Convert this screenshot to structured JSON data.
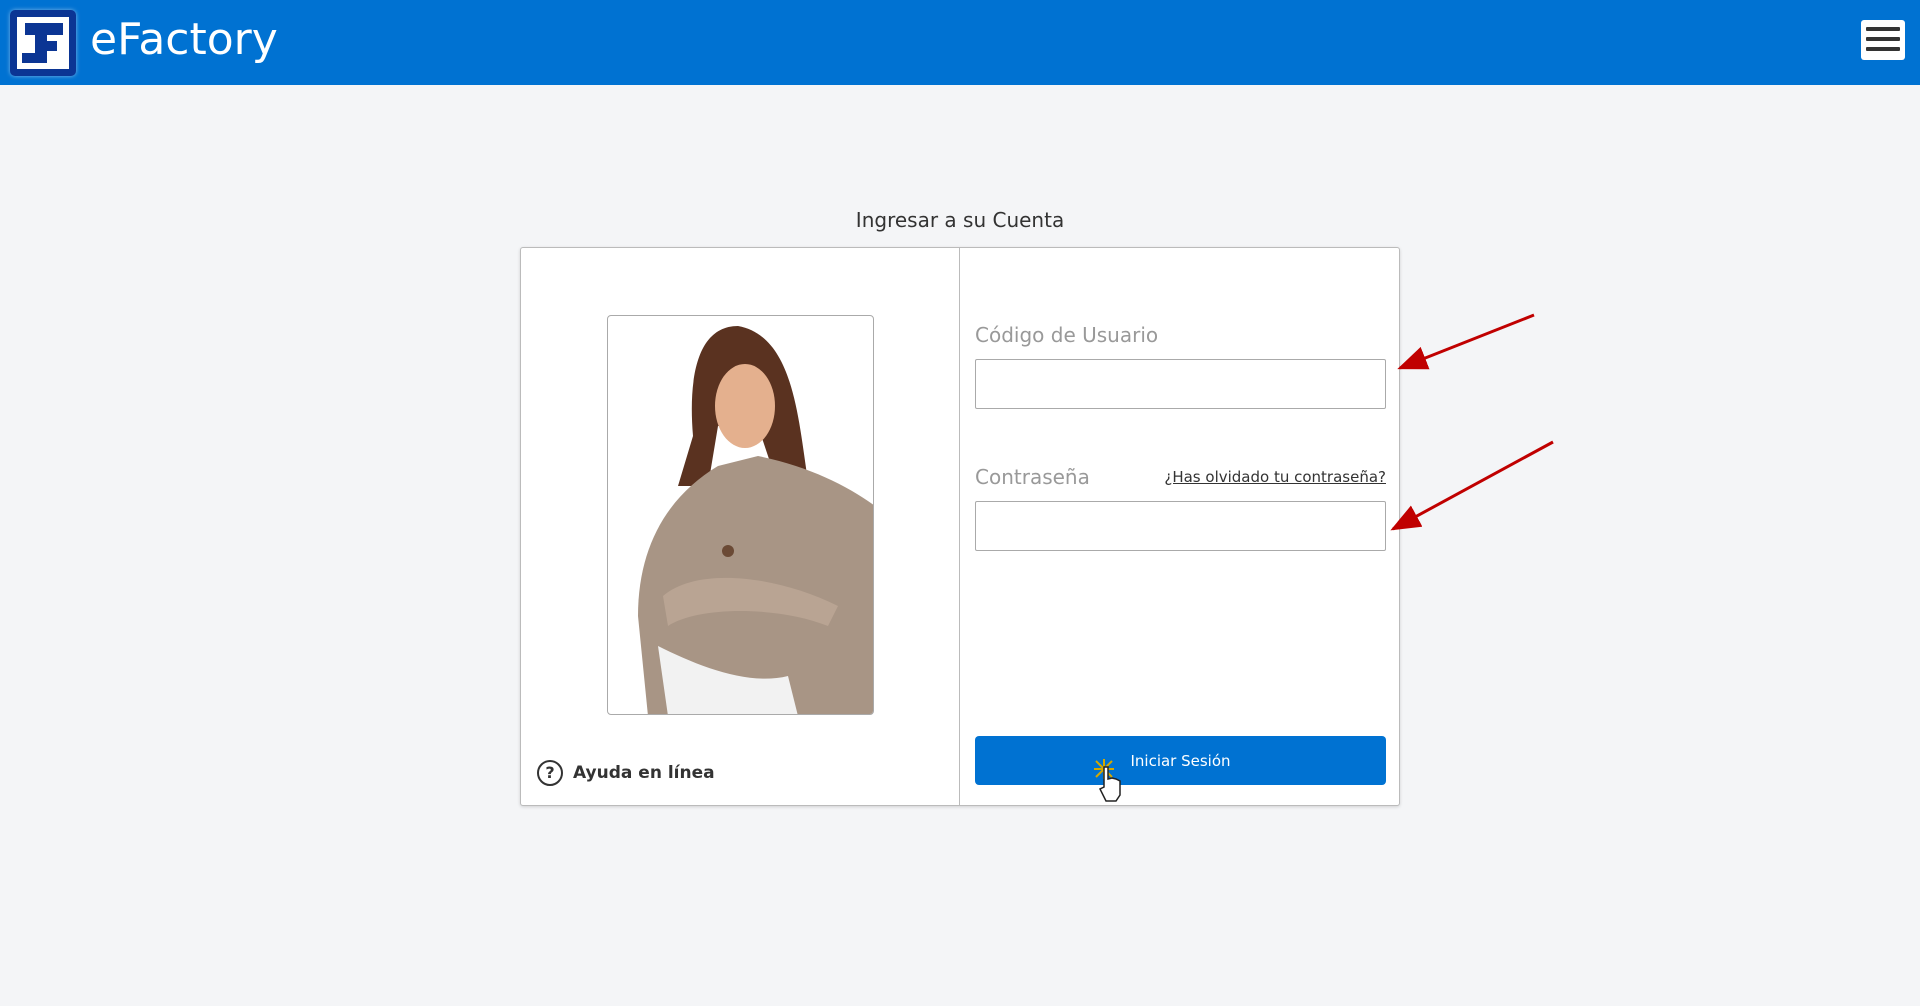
{
  "header": {
    "brand": "eFactory",
    "logo_icon": "efactory-logo",
    "menu_icon": "hamburger-menu-icon",
    "color": "#0072d2"
  },
  "login": {
    "title": "Ingresar a su Cuenta",
    "username_label": "Código de Usuario",
    "username_value": "",
    "password_label": "Contraseña",
    "password_value": "",
    "forgot_link": "¿Has olvidado tu contraseña?",
    "submit_label": "Iniciar Sesión",
    "help_label": "Ayuda en línea",
    "help_icon": "question-circle-icon"
  },
  "annotations": {
    "arrow_color": "#c00000"
  }
}
